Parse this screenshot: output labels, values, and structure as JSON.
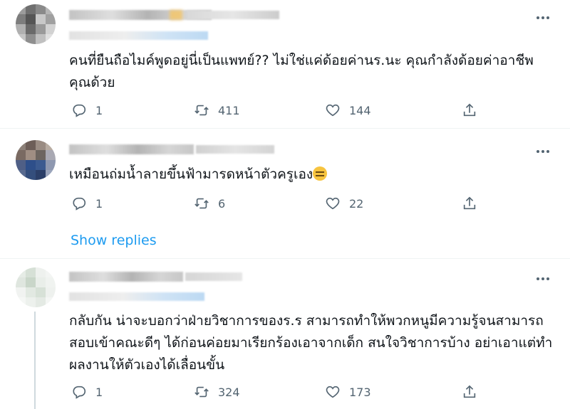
{
  "tweets": [
    {
      "text": "คนที่ยืนถือไมค์พูดอยู่นี่เป็นแพทย์?? ไม่ใช่แค่ด้อยค่านร.นะ คุณกำลังด้อยค่าอาชีพคุณด้วย",
      "reply_count": "1",
      "retweet_count": "411",
      "like_count": "144"
    },
    {
      "text": "เหมือนถ่มน้ำลายขึ้นฟ้ามารดหน้าตัวครูเอง",
      "reply_count": "1",
      "retweet_count": "6",
      "like_count": "22",
      "emoji": "expressionless-face-emoji"
    },
    {
      "text": "กลับกัน น่าจะบอกว่าฝ่ายวิชาการของร.ร สามารถทำให้พวกหนูมีความรู้จนสามารถสอบเข้าคณะดีๆ ได้ก่อนค่อยมาเรียกร้องเอาจากเด็ก สนใจวิชาการบ้าง อย่าเอาแต่ทำผลงานให้ตัวเองได้เลื่อนขั้น",
      "reply_count": "1",
      "retweet_count": "324",
      "like_count": "173"
    }
  ],
  "show_replies_label": "Show replies",
  "icons": {
    "reply": "reply-icon",
    "retweet": "retweet-icon",
    "like": "heart-icon",
    "share": "share-icon",
    "more": "more-icon"
  },
  "colors": {
    "link": "#1d9bf0",
    "muted": "#536471",
    "text": "#0f1419",
    "divider": "#eff3f4"
  }
}
